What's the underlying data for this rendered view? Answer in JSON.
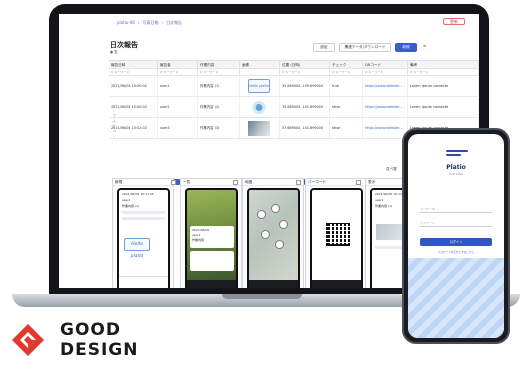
{
  "app": {
    "breadcrumbs": [
      "platio-06",
      "写真日報",
      "日次報告"
    ],
    "top_button": "更新",
    "page_title": "日次報告",
    "page_sub": "● 表",
    "buttons": {
      "settings": "設定",
      "export": "関連データ/ダウンロード",
      "new": "新規",
      "menu": "≡"
    },
    "columns": [
      "報告日時",
      "報告者",
      "作業内容",
      "画像",
      "位置 (日時)",
      "チェック",
      "QRコード",
      "備考"
    ],
    "filter_hint": "Q キーワード",
    "rows": [
      {
        "time": "2021/06/04 10:00:02",
        "user": "user1",
        "task": "作業内容 (1)",
        "geo": "35.669000, 139.699000",
        "check": "true",
        "url": "https://www.website...",
        "note": "Lorem ipsum consecte"
      },
      {
        "time": "2021/06/04 10:00:02",
        "user": "user2",
        "task": "作業内容 (2)",
        "geo": "35.669000, 141.699000",
        "check": "false",
        "url": "https://www.website...",
        "note": "Lorem ipsum consecte"
      },
      {
        "time": "2021/06/04 10:02:02",
        "user": "user3",
        "task": "作業内容 (3)",
        "geo": "37.669000, 141.699000",
        "check": "false",
        "url": "https://www.website...",
        "note": "Lorem ipsum consecte"
      }
    ],
    "vertical_label": "テーブルビュー",
    "sort_bar": [
      "並べ替",
      "大きめ",
      "ミ"
    ],
    "cards": [
      {
        "title": "新規",
        "time": "2021/06/05 10:13:05",
        "user": "user1",
        "task": "作業内容 (1)"
      },
      {
        "title": "一覧",
        "time": "2021/06/05",
        "user": "user1",
        "task": "作業内容"
      },
      {
        "title": "地図",
        "time": "",
        "user": "",
        "task": ""
      },
      {
        "title": "バーコード",
        "time": "",
        "user": "",
        "task": ""
      },
      {
        "title": "表示",
        "time": "2021/06/05 10:13:05",
        "user": "user1",
        "task": "作業内容 (1)"
      }
    ],
    "hello_text": "Hello platio"
  },
  "phone": {
    "app_name": "Platio",
    "app_sub": "Field Plate",
    "field1": "ユーザーID",
    "field2": "パスワード",
    "login": "ログイン",
    "link": "パスワードを忘れた方はこちら"
  },
  "award": {
    "line1": "GOOD",
    "line2": "DESIGN",
    "color": "#e03a2f"
  }
}
